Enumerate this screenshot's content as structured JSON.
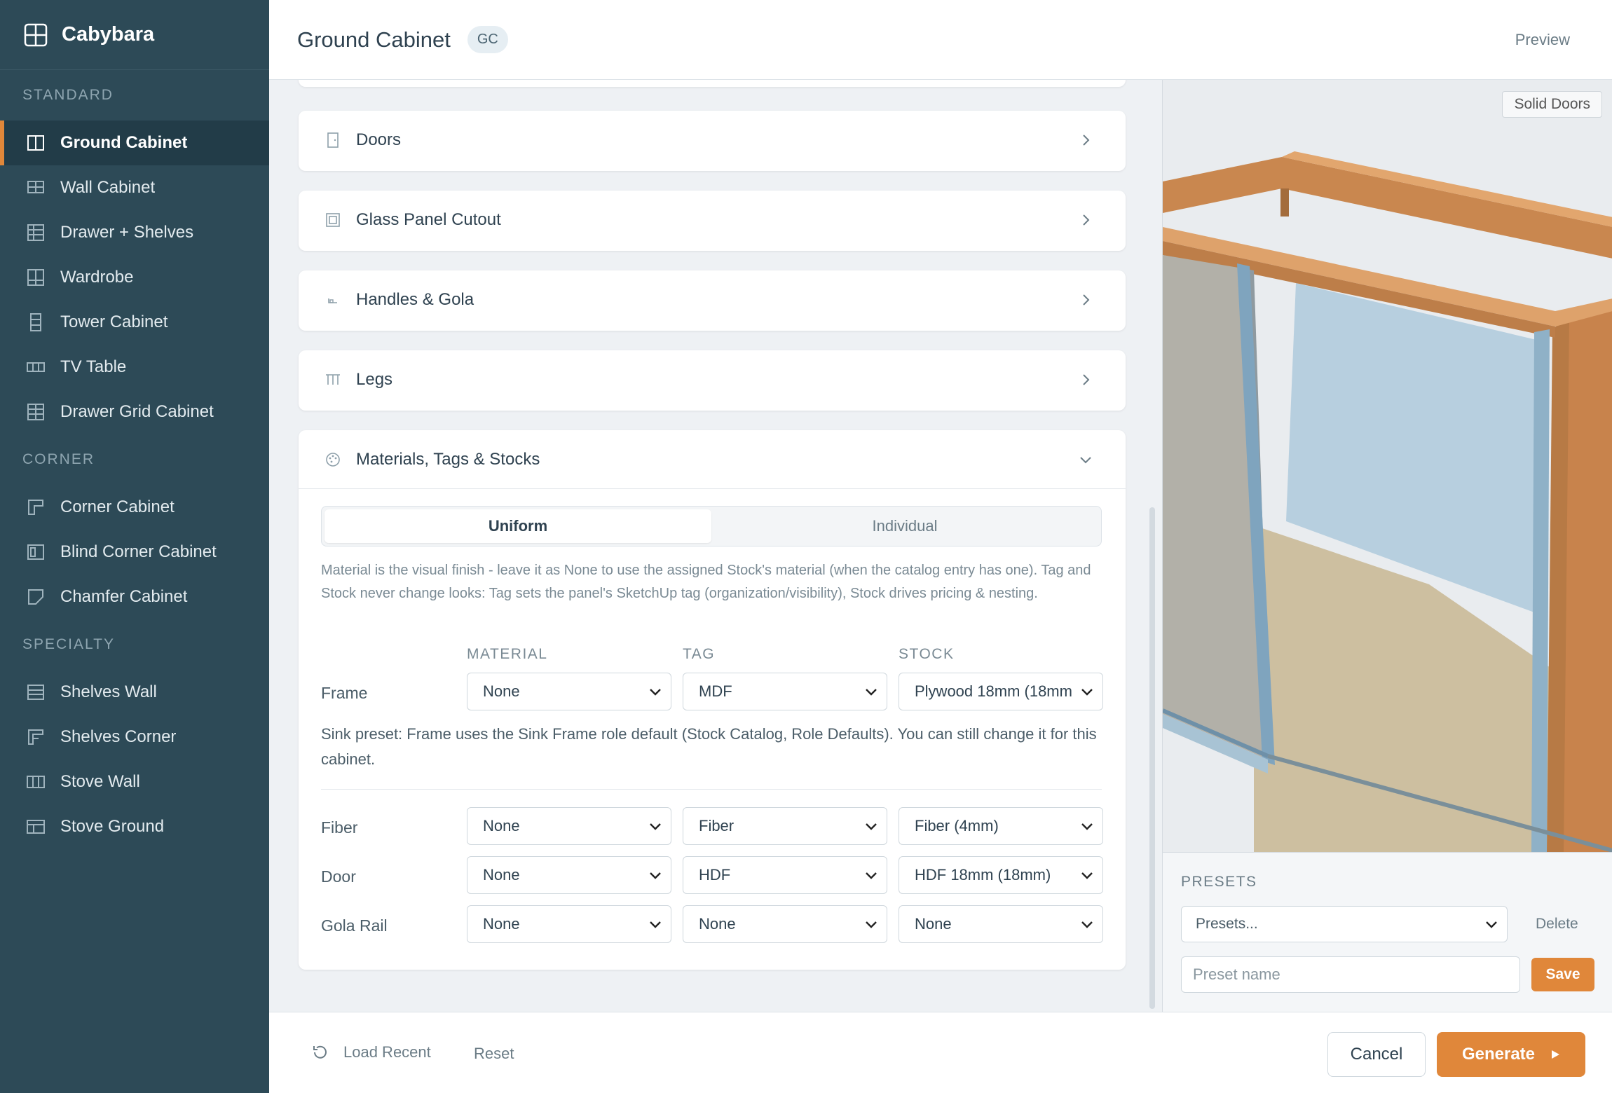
{
  "app": {
    "name": "Cabybara"
  },
  "sidebar": {
    "sections": [
      {
        "title": "STANDARD",
        "items": [
          {
            "label": "Ground Cabinet",
            "icon": "ground-cabinet-icon",
            "active": true
          },
          {
            "label": "Wall Cabinet",
            "icon": "wall-cabinet-icon"
          },
          {
            "label": "Drawer + Shelves",
            "icon": "drawer-shelves-icon"
          },
          {
            "label": "Wardrobe",
            "icon": "wardrobe-icon"
          },
          {
            "label": "Tower Cabinet",
            "icon": "tower-cabinet-icon"
          },
          {
            "label": "TV Table",
            "icon": "tv-table-icon"
          },
          {
            "label": "Drawer Grid Cabinet",
            "icon": "drawer-grid-icon"
          }
        ]
      },
      {
        "title": "CORNER",
        "items": [
          {
            "label": "Corner Cabinet",
            "icon": "corner-cabinet-icon"
          },
          {
            "label": "Blind Corner Cabinet",
            "icon": "blind-corner-icon"
          },
          {
            "label": "Chamfer Cabinet",
            "icon": "chamfer-cabinet-icon"
          }
        ]
      },
      {
        "title": "SPECIALTY",
        "items": [
          {
            "label": "Shelves Wall",
            "icon": "shelves-wall-icon"
          },
          {
            "label": "Shelves Corner",
            "icon": "shelves-corner-icon"
          },
          {
            "label": "Stove Wall",
            "icon": "stove-wall-icon"
          },
          {
            "label": "Stove Ground",
            "icon": "stove-ground-icon"
          }
        ]
      }
    ]
  },
  "header": {
    "title": "Ground Cabinet",
    "badge": "GC",
    "preview_label": "Preview"
  },
  "sections": {
    "doors": "Doors",
    "glass": "Glass Panel Cutout",
    "handles": "Handles & Gola",
    "legs": "Legs",
    "materials": "Materials, Tags & Stocks"
  },
  "materials": {
    "tabs": {
      "uniform": "Uniform",
      "individual": "Individual",
      "active": "Uniform"
    },
    "help": "Material is the visual finish - leave it as None to use the assigned Stock's material (when the catalog entry has one). Tag and Stock never change looks: Tag sets the panel's SketchUp tag (organization/visibility), Stock drives pricing & nesting.",
    "columns": {
      "material": "MATERIAL",
      "tag": "TAG",
      "stock": "STOCK"
    },
    "sink_note": "Sink preset: Frame uses the Sink Frame role default (Stock Catalog, Role Defaults). You can still change it for this cabinet.",
    "rows": [
      {
        "label": "Frame",
        "material": "None",
        "tag": "MDF",
        "stock": "Plywood 18mm (18mm"
      },
      {
        "label": "Fiber",
        "material": "None",
        "tag": "Fiber",
        "stock": "Fiber (4mm)"
      },
      {
        "label": "Door",
        "material": "None",
        "tag": "HDF",
        "stock": "HDF 18mm (18mm)"
      },
      {
        "label": "Gola Rail",
        "material": "None",
        "tag": "None",
        "stock": "None"
      }
    ]
  },
  "viewport": {
    "mode_button": "Solid Doors",
    "colors": {
      "wood": "#d99a62",
      "glass": "#b7cfdf",
      "floor": "#cdbfa0"
    }
  },
  "presets": {
    "title": "PRESETS",
    "select_value": "Presets...",
    "delete_label": "Delete",
    "name_placeholder": "Preset name",
    "save_label": "Save"
  },
  "footer": {
    "load_recent": "Load Recent",
    "reset": "Reset",
    "cancel": "Cancel",
    "generate": "Generate"
  },
  "accent": "#e0873a"
}
